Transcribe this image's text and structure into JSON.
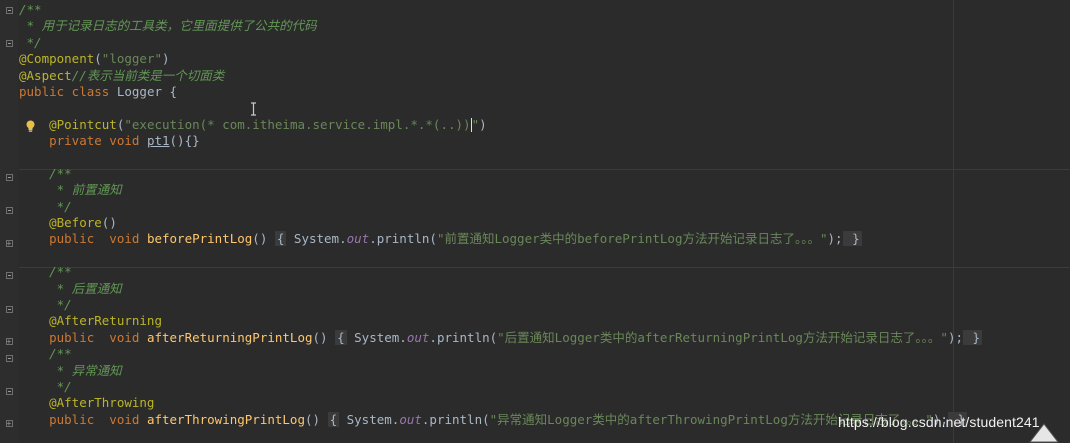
{
  "lines": [
    {
      "parts": [
        {
          "t": "/**",
          "c": "comment"
        }
      ]
    },
    {
      "parts": [
        {
          "t": " * 用于记录日志的工具类，它里面提供了公共的代码",
          "c": "comment"
        }
      ]
    },
    {
      "parts": [
        {
          "t": " */",
          "c": "comment"
        }
      ]
    },
    {
      "parts": [
        {
          "t": "@Component",
          "c": "ann"
        },
        {
          "t": "(",
          "c": "plain"
        },
        {
          "t": "\"logger\"",
          "c": "str"
        },
        {
          "t": ")",
          "c": "plain"
        }
      ]
    },
    {
      "parts": [
        {
          "t": "@Aspect",
          "c": "ann"
        },
        {
          "t": "//表示当前类是一个切面类",
          "c": "comment"
        }
      ]
    },
    {
      "parts": [
        {
          "t": "public class ",
          "c": "kw"
        },
        {
          "t": "Logger {",
          "c": "plain"
        }
      ]
    },
    {
      "parts": []
    },
    {
      "parts": [
        {
          "t": "    @Pointcut",
          "c": "ann"
        },
        {
          "t": "(",
          "c": "plain"
        },
        {
          "t": "\"execution(* com.itheima.service.impl.*.*(..))",
          "c": "str"
        },
        {
          "t": "CARET",
          "c": "caret"
        },
        {
          "t": "\"",
          "c": "str"
        },
        {
          "t": ")",
          "c": "plain"
        }
      ]
    },
    {
      "parts": [
        {
          "t": "    private void ",
          "c": "kw"
        },
        {
          "t": "pt1",
          "c": "ref"
        },
        {
          "t": "(){}",
          "c": "plain"
        }
      ]
    },
    {
      "parts": []
    },
    {
      "parts": [
        {
          "t": "    /**",
          "c": "comment"
        }
      ]
    },
    {
      "parts": [
        {
          "t": "     * 前置通知",
          "c": "comment"
        }
      ]
    },
    {
      "parts": [
        {
          "t": "     */",
          "c": "comment"
        }
      ]
    },
    {
      "parts": [
        {
          "t": "    @Before",
          "c": "ann"
        },
        {
          "t": "()",
          "c": "plain"
        }
      ]
    },
    {
      "parts": [
        {
          "t": "    public  void ",
          "c": "kw"
        },
        {
          "t": "beforePrintLog",
          "c": "method"
        },
        {
          "t": "() ",
          "c": "plain"
        },
        {
          "t": "{",
          "c": "brace"
        },
        {
          "t": " System.",
          "c": "plain"
        },
        {
          "t": "out",
          "c": "out"
        },
        {
          "t": ".println(",
          "c": "plain"
        },
        {
          "t": "\"前置通知Logger类中的beforePrintLog方法开始记录日志了。。。\"",
          "c": "str"
        },
        {
          "t": ");",
          "c": "plain"
        },
        {
          "t": " }",
          "c": "brace"
        }
      ]
    },
    {
      "parts": []
    },
    {
      "parts": [
        {
          "t": "    /**",
          "c": "comment"
        }
      ]
    },
    {
      "parts": [
        {
          "t": "     * 后置通知",
          "c": "comment"
        }
      ]
    },
    {
      "parts": [
        {
          "t": "     */",
          "c": "comment"
        }
      ]
    },
    {
      "parts": [
        {
          "t": "    @AfterReturning",
          "c": "ann"
        }
      ]
    },
    {
      "parts": [
        {
          "t": "    public  void ",
          "c": "kw"
        },
        {
          "t": "afterReturningPrintLog",
          "c": "method"
        },
        {
          "t": "() ",
          "c": "plain"
        },
        {
          "t": "{",
          "c": "brace"
        },
        {
          "t": " System.",
          "c": "plain"
        },
        {
          "t": "out",
          "c": "out"
        },
        {
          "t": ".println(",
          "c": "plain"
        },
        {
          "t": "\"后置通知Logger类中的afterReturningPrintLog方法开始记录日志了。。。\"",
          "c": "str"
        },
        {
          "t": ");",
          "c": "plain"
        },
        {
          "t": " }",
          "c": "brace"
        }
      ]
    },
    {
      "parts": [
        {
          "t": "    /**",
          "c": "comment"
        }
      ]
    },
    {
      "parts": [
        {
          "t": "     * 异常通知",
          "c": "comment"
        }
      ]
    },
    {
      "parts": [
        {
          "t": "     */",
          "c": "comment"
        }
      ]
    },
    {
      "parts": [
        {
          "t": "    @AfterThrowing",
          "c": "ann"
        }
      ]
    },
    {
      "parts": [
        {
          "t": "    public  void ",
          "c": "kw"
        },
        {
          "t": "afterThrowingPrintLog",
          "c": "method"
        },
        {
          "t": "() ",
          "c": "plain"
        },
        {
          "t": "{",
          "c": "brace"
        },
        {
          "t": " System.",
          "c": "plain"
        },
        {
          "t": "out",
          "c": "out"
        },
        {
          "t": ".println(",
          "c": "plain"
        },
        {
          "t": "\"异常通知Logger类中的afterThrowingPrintLog方法开始记录日志了。。。\"",
          "c": "str"
        },
        {
          "t": ");",
          "c": "plain"
        },
        {
          "t": " }",
          "c": "brace"
        }
      ]
    }
  ],
  "watermark": "https://blog.csdn.net/student241",
  "icons": {
    "bulb": "lightbulb-icon",
    "cursor": "text-cursor-icon",
    "pointer": "mouse-pointer-icon"
  },
  "colors": {
    "background": "#2b2b2b",
    "keyword": "#cc7832",
    "annotation": "#bbb529",
    "string": "#6a8759",
    "comment": "#629755",
    "method": "#ffc66d",
    "field": "#9876aa"
  }
}
